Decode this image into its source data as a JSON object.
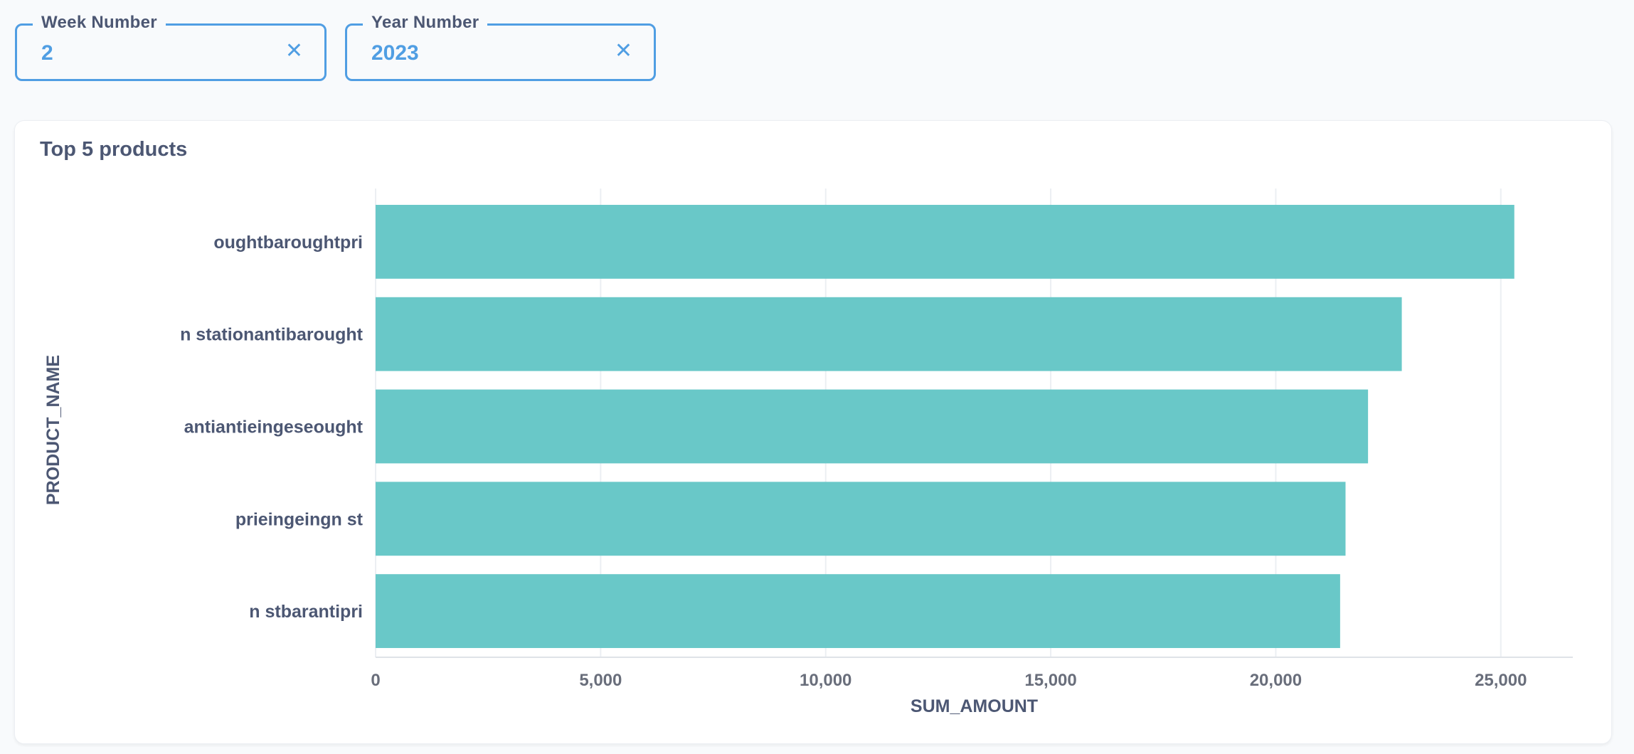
{
  "filters": {
    "week": {
      "label": "Week Number",
      "value": "2",
      "clear_icon": "close-icon"
    },
    "year": {
      "label": "Year Number",
      "value": "2023",
      "clear_icon": "close-icon"
    }
  },
  "card": {
    "title": "Top 5 products"
  },
  "chart_data": {
    "type": "bar",
    "orientation": "horizontal",
    "categories": [
      "oughtbaroughtpri",
      "n stationantibarought",
      "antiantieingeseought",
      "prieingeingn st",
      "n stbarantipri"
    ],
    "values": [
      25300,
      22800,
      22050,
      21550,
      21430
    ],
    "xlabel": "SUM_AMOUNT",
    "ylabel": "PRODUCT_NAME",
    "xlim": [
      0,
      26600
    ],
    "x_ticks": [
      0,
      5000,
      10000,
      15000,
      20000,
      25000
    ],
    "x_tick_labels": [
      "0",
      "5,000",
      "10,000",
      "15,000",
      "20,000",
      "25,000"
    ],
    "bar_color": "#69c8c8",
    "grid": true
  },
  "colors": {
    "accent": "#509ee3",
    "text": "#4c5773",
    "bar": "#69c8c8",
    "grid": "#eceff3"
  }
}
